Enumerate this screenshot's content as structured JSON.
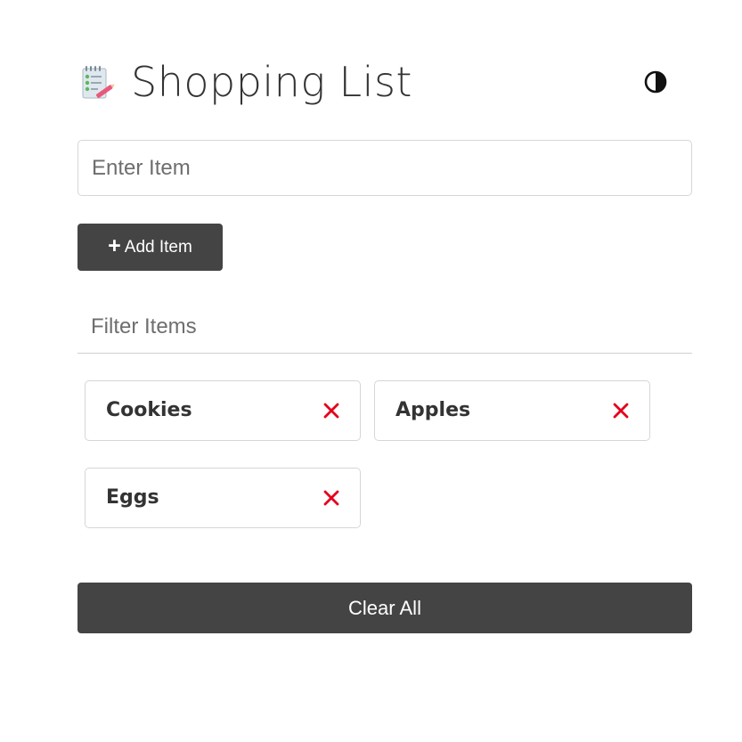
{
  "header": {
    "logo_icon": "notepad-checklist-icon",
    "title": "Shopping List",
    "theme_toggle_icon": "half-circle-contrast-icon"
  },
  "form": {
    "item_input": {
      "placeholder": "Enter Item",
      "value": ""
    },
    "add_button": {
      "icon": "plus-icon",
      "label": "Add Item"
    }
  },
  "filter": {
    "placeholder": "Filter Items",
    "value": ""
  },
  "items": [
    {
      "name": "Cookies",
      "remove_icon": "close-x-icon"
    },
    {
      "name": "Apples",
      "remove_icon": "close-x-icon"
    },
    {
      "name": "Eggs",
      "remove_icon": "close-x-icon"
    }
  ],
  "clear_button": {
    "label": "Clear All"
  },
  "colors": {
    "button_bg": "#444444",
    "button_text": "#ffffff",
    "remove_icon": "#e3001b",
    "border": "#d6d6d6",
    "text": "#333333"
  }
}
